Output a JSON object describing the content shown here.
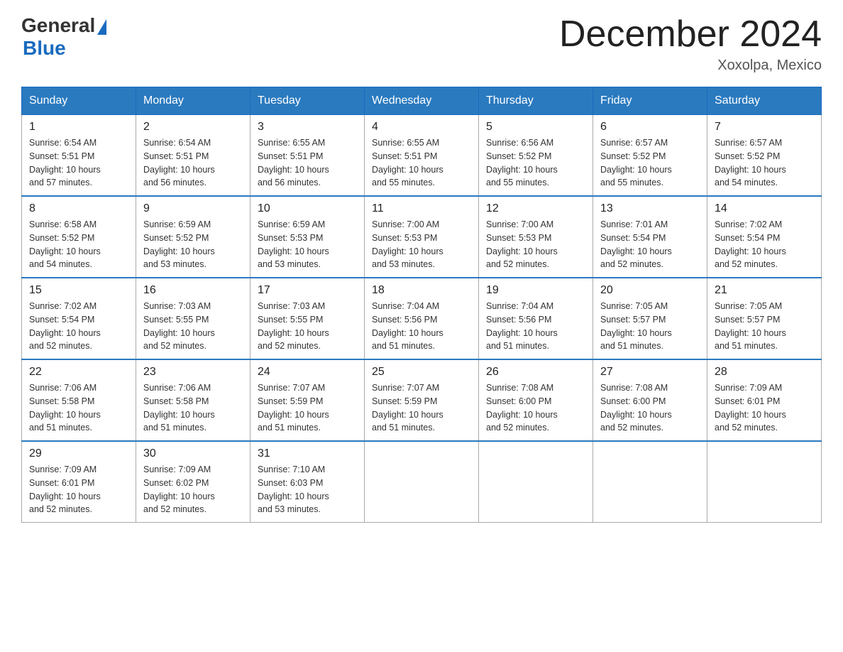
{
  "header": {
    "logo_general": "General",
    "logo_blue": "Blue",
    "month_title": "December 2024",
    "location": "Xoxolpa, Mexico"
  },
  "days_of_week": [
    "Sunday",
    "Monday",
    "Tuesday",
    "Wednesday",
    "Thursday",
    "Friday",
    "Saturday"
  ],
  "weeks": [
    [
      {
        "day": "1",
        "sunrise": "6:54 AM",
        "sunset": "5:51 PM",
        "daylight": "10 hours and 57 minutes."
      },
      {
        "day": "2",
        "sunrise": "6:54 AM",
        "sunset": "5:51 PM",
        "daylight": "10 hours and 56 minutes."
      },
      {
        "day": "3",
        "sunrise": "6:55 AM",
        "sunset": "5:51 PM",
        "daylight": "10 hours and 56 minutes."
      },
      {
        "day": "4",
        "sunrise": "6:55 AM",
        "sunset": "5:51 PM",
        "daylight": "10 hours and 55 minutes."
      },
      {
        "day": "5",
        "sunrise": "6:56 AM",
        "sunset": "5:52 PM",
        "daylight": "10 hours and 55 minutes."
      },
      {
        "day": "6",
        "sunrise": "6:57 AM",
        "sunset": "5:52 PM",
        "daylight": "10 hours and 55 minutes."
      },
      {
        "day": "7",
        "sunrise": "6:57 AM",
        "sunset": "5:52 PM",
        "daylight": "10 hours and 54 minutes."
      }
    ],
    [
      {
        "day": "8",
        "sunrise": "6:58 AM",
        "sunset": "5:52 PM",
        "daylight": "10 hours and 54 minutes."
      },
      {
        "day": "9",
        "sunrise": "6:59 AM",
        "sunset": "5:52 PM",
        "daylight": "10 hours and 53 minutes."
      },
      {
        "day": "10",
        "sunrise": "6:59 AM",
        "sunset": "5:53 PM",
        "daylight": "10 hours and 53 minutes."
      },
      {
        "day": "11",
        "sunrise": "7:00 AM",
        "sunset": "5:53 PM",
        "daylight": "10 hours and 53 minutes."
      },
      {
        "day": "12",
        "sunrise": "7:00 AM",
        "sunset": "5:53 PM",
        "daylight": "10 hours and 52 minutes."
      },
      {
        "day": "13",
        "sunrise": "7:01 AM",
        "sunset": "5:54 PM",
        "daylight": "10 hours and 52 minutes."
      },
      {
        "day": "14",
        "sunrise": "7:02 AM",
        "sunset": "5:54 PM",
        "daylight": "10 hours and 52 minutes."
      }
    ],
    [
      {
        "day": "15",
        "sunrise": "7:02 AM",
        "sunset": "5:54 PM",
        "daylight": "10 hours and 52 minutes."
      },
      {
        "day": "16",
        "sunrise": "7:03 AM",
        "sunset": "5:55 PM",
        "daylight": "10 hours and 52 minutes."
      },
      {
        "day": "17",
        "sunrise": "7:03 AM",
        "sunset": "5:55 PM",
        "daylight": "10 hours and 52 minutes."
      },
      {
        "day": "18",
        "sunrise": "7:04 AM",
        "sunset": "5:56 PM",
        "daylight": "10 hours and 51 minutes."
      },
      {
        "day": "19",
        "sunrise": "7:04 AM",
        "sunset": "5:56 PM",
        "daylight": "10 hours and 51 minutes."
      },
      {
        "day": "20",
        "sunrise": "7:05 AM",
        "sunset": "5:57 PM",
        "daylight": "10 hours and 51 minutes."
      },
      {
        "day": "21",
        "sunrise": "7:05 AM",
        "sunset": "5:57 PM",
        "daylight": "10 hours and 51 minutes."
      }
    ],
    [
      {
        "day": "22",
        "sunrise": "7:06 AM",
        "sunset": "5:58 PM",
        "daylight": "10 hours and 51 minutes."
      },
      {
        "day": "23",
        "sunrise": "7:06 AM",
        "sunset": "5:58 PM",
        "daylight": "10 hours and 51 minutes."
      },
      {
        "day": "24",
        "sunrise": "7:07 AM",
        "sunset": "5:59 PM",
        "daylight": "10 hours and 51 minutes."
      },
      {
        "day": "25",
        "sunrise": "7:07 AM",
        "sunset": "5:59 PM",
        "daylight": "10 hours and 51 minutes."
      },
      {
        "day": "26",
        "sunrise": "7:08 AM",
        "sunset": "6:00 PM",
        "daylight": "10 hours and 52 minutes."
      },
      {
        "day": "27",
        "sunrise": "7:08 AM",
        "sunset": "6:00 PM",
        "daylight": "10 hours and 52 minutes."
      },
      {
        "day": "28",
        "sunrise": "7:09 AM",
        "sunset": "6:01 PM",
        "daylight": "10 hours and 52 minutes."
      }
    ],
    [
      {
        "day": "29",
        "sunrise": "7:09 AM",
        "sunset": "6:01 PM",
        "daylight": "10 hours and 52 minutes."
      },
      {
        "day": "30",
        "sunrise": "7:09 AM",
        "sunset": "6:02 PM",
        "daylight": "10 hours and 52 minutes."
      },
      {
        "day": "31",
        "sunrise": "7:10 AM",
        "sunset": "6:03 PM",
        "daylight": "10 hours and 53 minutes."
      },
      null,
      null,
      null,
      null
    ]
  ]
}
